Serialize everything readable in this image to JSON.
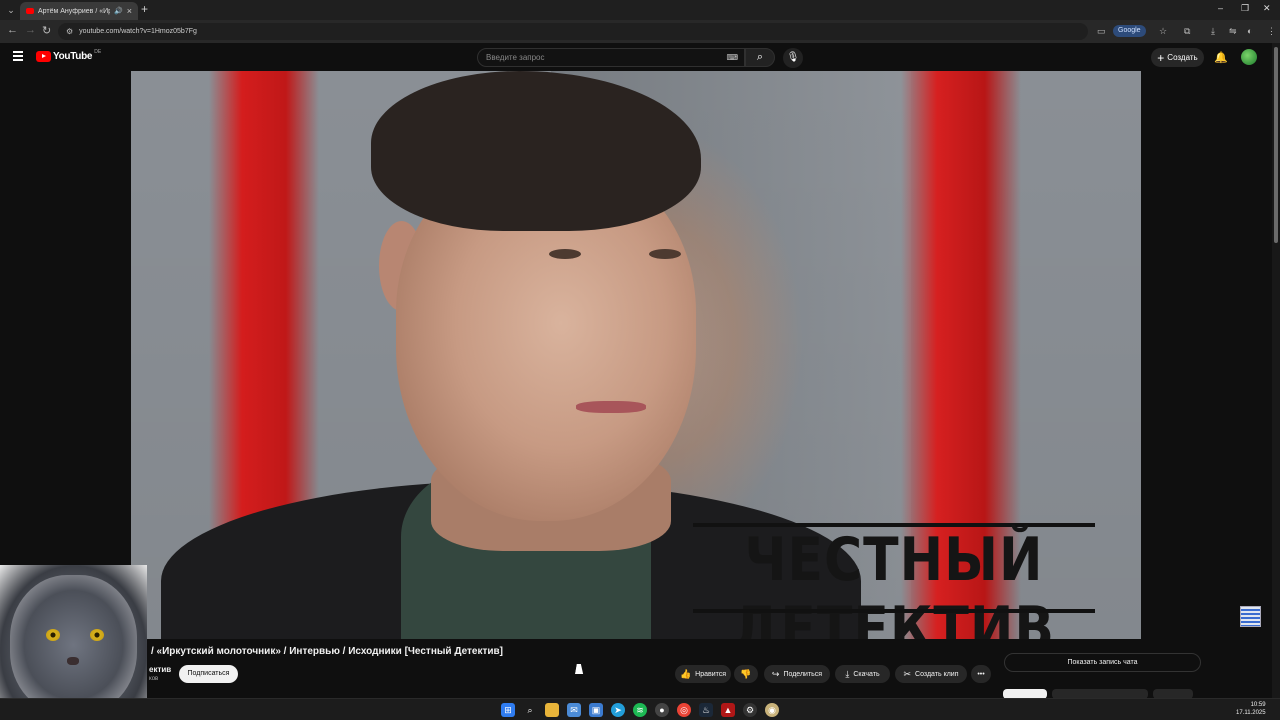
{
  "browser": {
    "tab_title": "Артём Ануфриев / «Иркут",
    "new_tab_glyph": "+",
    "url": "youtube.com/watch?v=1Hmoz05b7Fg",
    "google_chip": "Google"
  },
  "header": {
    "logo_text": "YouTube",
    "region": "DE",
    "search_placeholder": "Введите запрос",
    "create_label": "Создать"
  },
  "video": {
    "overlay_logo": "ЧЕСТНЫЙ ДЕТЕКТИВ",
    "title": "/ «Иркутский молоточник» / Интервью / Исходники [Честный Детектив]",
    "channel_name": "ектив",
    "channel_subs": "ков"
  },
  "actions": {
    "subscribe": "Подписаться",
    "like": "Нравится",
    "share": "Поделиться",
    "download": "Скачать",
    "clip": "Создать клип",
    "more": "•••"
  },
  "chat": {
    "show_replay": "Показать запись чата"
  },
  "taskbar": {
    "time": "10:59",
    "date": "17.11.2025"
  },
  "colors": {
    "youtube_red": "#ff0000",
    "background": "#0f0f0f"
  }
}
